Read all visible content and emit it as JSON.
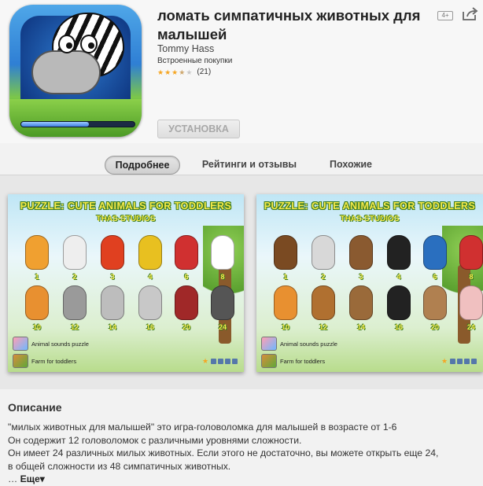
{
  "app": {
    "title": "ломать симпатичных животных для малышей",
    "developer": "Tommy Hass",
    "in_app_purchases": "Встроенные покупки",
    "rating_stars": 3.5,
    "rating_count": "(21)",
    "age_rating": "4+",
    "install_label": "УСТАНОВКА",
    "download_progress": 0.6
  },
  "icons": {
    "share": "share-icon",
    "app": "zebra-app-icon"
  },
  "tabs": [
    {
      "label": "Подробнее",
      "active": true
    },
    {
      "label": "Рейтинги и отзывы",
      "active": false
    },
    {
      "label": "Похожие",
      "active": false
    }
  ],
  "screenshots": [
    {
      "title": "PUZZLE: CUTE ANIMALS FOR TODDLERS",
      "studio": "THAS-STUDIOS",
      "row1_numbers": [
        "1",
        "2",
        "3",
        "4",
        "6",
        "8"
      ],
      "row2_numbers": [
        "10",
        "12",
        "14",
        "16",
        "20",
        "24"
      ],
      "link1": "Animal sounds puzzle",
      "link2": "Farm for toddlers"
    },
    {
      "title": "PUZZLE: CUTE ANIMALS FOR TODDLERS",
      "studio": "THAS-STUDIOS",
      "row1_numbers": [
        "1",
        "2",
        "3",
        "4",
        "6",
        "8"
      ],
      "row2_numbers": [
        "10",
        "12",
        "14",
        "16",
        "20",
        "24"
      ],
      "link1": "Animal sounds puzzle",
      "link2": "Farm for toddlers"
    }
  ],
  "description": {
    "heading": "Описание",
    "lines": [
      "\"милых животных для малышей\" это игра-головоломка для малышей в возрасте от 1-6",
      "Он содержит 12 головоломок с различными уровнями сложности.",
      "Он имеет 24 различных милых животных. Если этого не достаточно, вы можете открыть еще 24,",
      "в общей сложности из 48 симпатичных животных."
    ],
    "ellipsis": "…",
    "more_label": "Еще▾"
  },
  "colors": {
    "star": "#f5a623",
    "title_text": "#222222",
    "install_text": "#a8a8a8"
  }
}
